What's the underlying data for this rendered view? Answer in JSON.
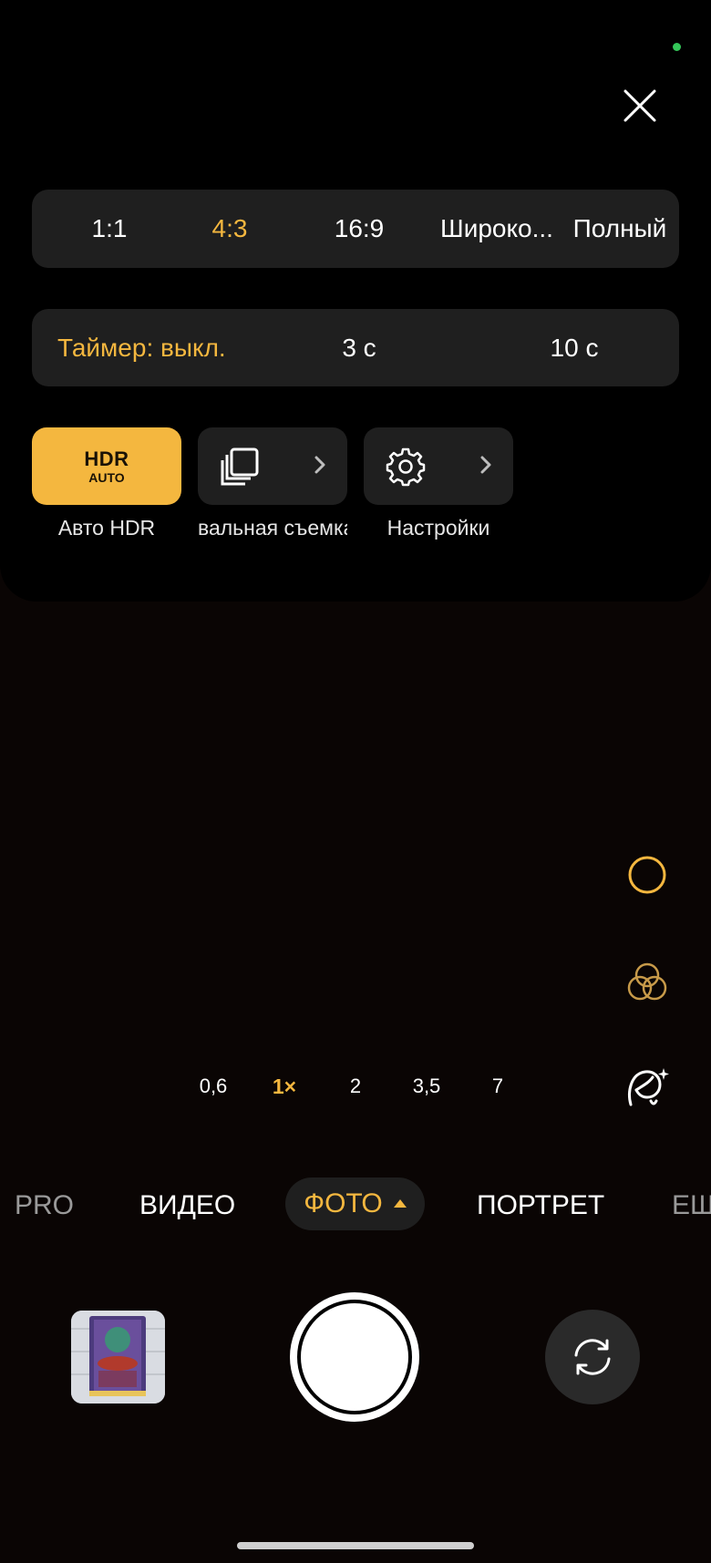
{
  "colors": {
    "accent": "#f4b73f",
    "panel": "#1f1f1f",
    "background": "#000000"
  },
  "aspect_ratios": {
    "items": [
      "1:1",
      "4:3",
      "16:9",
      "Широко...",
      "Полный"
    ],
    "selected": "4:3"
  },
  "timer": {
    "items": [
      "Таймер: выкл.",
      "3 с",
      "10 с"
    ],
    "selected": "Таймер: выкл."
  },
  "tiles": {
    "hdr": {
      "line1": "HDR",
      "line2": "AUTO",
      "label": "Авто HDR"
    },
    "burst": {
      "label": "вальная съемка",
      "icon": "burst-stack-icon"
    },
    "settings": {
      "label": "Настройки",
      "icon": "gear-icon"
    }
  },
  "zoom": {
    "levels": [
      "0,6",
      "1×",
      "2",
      "3,5",
      "7"
    ],
    "selected": "1×"
  },
  "modes": {
    "items": [
      "PRO",
      "ВИДЕО",
      "ФОТО",
      "ПОРТРЕТ",
      "ЕЩЕ"
    ],
    "selected": "ФОТО"
  },
  "side_controls": [
    "focus-ring-icon",
    "filters-icon",
    "beauty-icon"
  ],
  "bottom": {
    "gallery": "gallery-thumbnail",
    "shutter": "shutter-button",
    "switch": "camera-switch-icon"
  }
}
